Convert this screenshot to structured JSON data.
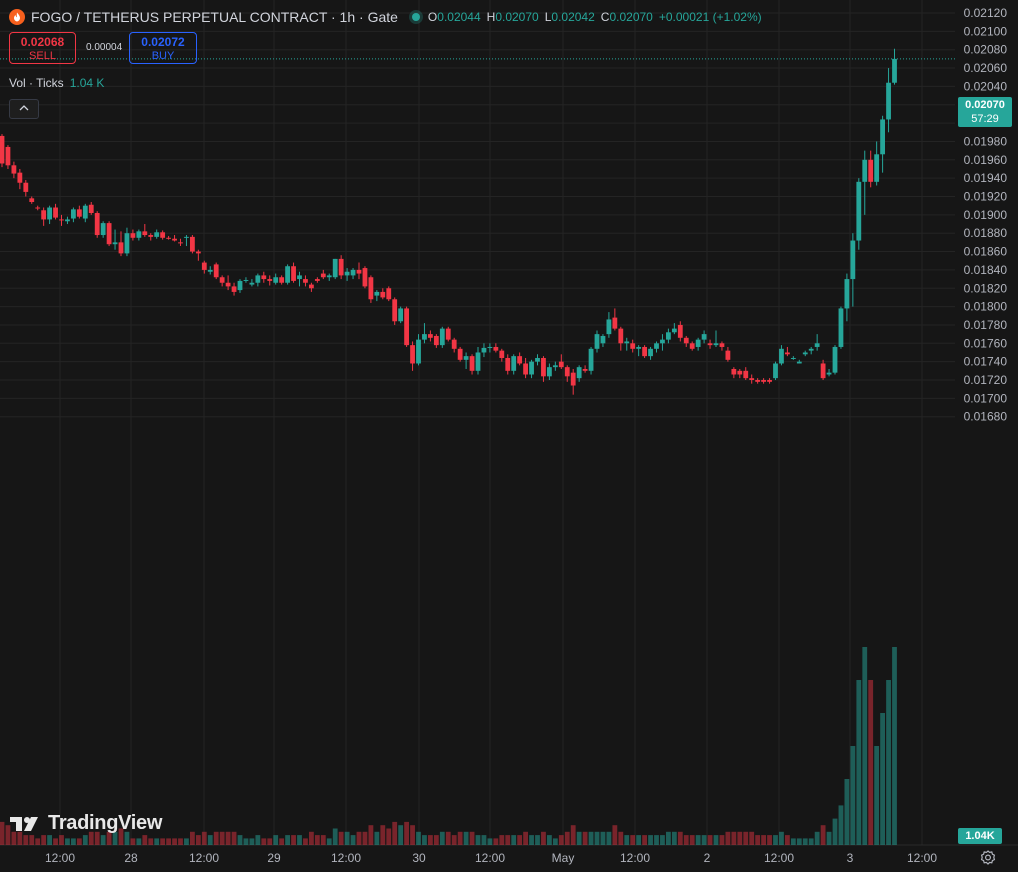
{
  "legend": {
    "symbol": "FOGO / TETHERUS PERPETUAL CONTRACT · 1h · Gate",
    "o_label": "O",
    "o": "0.02044",
    "h_label": "H",
    "h": "0.02070",
    "l_label": "L",
    "l": "0.02042",
    "c_label": "C",
    "c": "0.02070",
    "change": "+0.00021 (+1.02%)"
  },
  "trade": {
    "sell_price": "0.02068",
    "sell_label": "SELL",
    "spread": "0.00004",
    "buy_price": "0.02072",
    "buy_label": "BUY"
  },
  "volume_legend": {
    "label": "Vol · Ticks",
    "value": "1.04 K"
  },
  "price_tag": {
    "price": "0.02070",
    "countdown": "57:29"
  },
  "volume_tag": "1.04K",
  "watermark": "TradingView",
  "colors": {
    "up": "#26a69a",
    "down": "#f23645",
    "background": "#161616",
    "grid": "#242424",
    "axis_text": "#b2b5be"
  },
  "chart_data": {
    "type": "candlestick",
    "title": "FOGO / TETHERUS PERPETUAL CONTRACT · 1h · Gate",
    "y_axis": {
      "ticks": [
        "0.02120",
        "0.02100",
        "0.02080",
        "0.02060",
        "0.02040",
        "0.02020",
        "0.02000",
        "0.01980",
        "0.01960",
        "0.01940",
        "0.01920",
        "0.01900",
        "0.01880",
        "0.01860",
        "0.01840",
        "0.01820",
        "0.01800",
        "0.01780",
        "0.01760",
        "0.01740",
        "0.01720",
        "0.01700",
        "0.01680"
      ],
      "range": [
        0.01672,
        0.02126
      ]
    },
    "x_axis": {
      "ticks": [
        "12:00",
        "28",
        "12:00",
        "29",
        "12:00",
        "30",
        "12:00",
        "May",
        "12:00",
        "2",
        "12:00",
        "3",
        "12:00"
      ]
    },
    "last_price": 0.0207,
    "candles": [
      [
        0.01986,
        0.01988,
        0.01952,
        0.01956,
        0.35
      ],
      [
        0.01974,
        0.01976,
        0.0195,
        0.01954,
        0.3
      ],
      [
        0.01954,
        0.01958,
        0.0194,
        0.01945,
        0.2
      ],
      [
        0.01946,
        0.0195,
        0.01928,
        0.01935,
        0.2
      ],
      [
        0.01935,
        0.01938,
        0.0192,
        0.01925,
        0.15
      ],
      [
        0.01918,
        0.0192,
        0.01912,
        0.01914,
        0.15
      ],
      [
        0.01908,
        0.0191,
        0.01905,
        0.01907,
        0.1
      ],
      [
        0.01905,
        0.01908,
        0.01888,
        0.01895,
        0.15
      ],
      [
        0.01895,
        0.0191,
        0.0189,
        0.01908,
        0.15
      ],
      [
        0.01908,
        0.01912,
        0.01895,
        0.01897,
        0.1
      ],
      [
        0.01895,
        0.019,
        0.01888,
        0.01894,
        0.15
      ],
      [
        0.01893,
        0.01898,
        0.0189,
        0.01895,
        0.1
      ],
      [
        0.01896,
        0.01908,
        0.01892,
        0.01906,
        0.1
      ],
      [
        0.01906,
        0.0191,
        0.01896,
        0.01898,
        0.1
      ],
      [
        0.01896,
        0.01912,
        0.01892,
        0.0191,
        0.15
      ],
      [
        0.01911,
        0.01914,
        0.019,
        0.01902,
        0.2
      ],
      [
        0.01902,
        0.01904,
        0.01875,
        0.01878,
        0.2
      ],
      [
        0.01878,
        0.01893,
        0.01875,
        0.01891,
        0.15
      ],
      [
        0.01891,
        0.01893,
        0.01866,
        0.01868,
        0.2
      ],
      [
        0.01868,
        0.01884,
        0.01862,
        0.0187,
        0.2
      ],
      [
        0.0187,
        0.01882,
        0.01855,
        0.01858,
        0.25
      ],
      [
        0.01858,
        0.01886,
        0.01855,
        0.0188,
        0.2
      ],
      [
        0.0188,
        0.01884,
        0.01872,
        0.01875,
        0.1
      ],
      [
        0.01875,
        0.01884,
        0.01872,
        0.01882,
        0.1
      ],
      [
        0.01882,
        0.0189,
        0.01876,
        0.01878,
        0.15
      ],
      [
        0.01878,
        0.0188,
        0.01872,
        0.01876,
        0.1
      ],
      [
        0.01876,
        0.01884,
        0.01874,
        0.01881,
        0.1
      ],
      [
        0.01881,
        0.01883,
        0.01873,
        0.01875,
        0.1
      ],
      [
        0.01875,
        0.01877,
        0.01873,
        0.01874,
        0.1
      ],
      [
        0.01874,
        0.01878,
        0.01871,
        0.01872,
        0.1
      ],
      [
        0.0187,
        0.01874,
        0.01866,
        0.01869,
        0.1
      ],
      [
        0.01876,
        0.01878,
        0.01866,
        0.01876,
        0.1
      ],
      [
        0.01876,
        0.01878,
        0.01858,
        0.0186,
        0.2
      ],
      [
        0.0186,
        0.01862,
        0.0185,
        0.01858,
        0.15
      ],
      [
        0.01848,
        0.0185,
        0.01836,
        0.0184,
        0.2
      ],
      [
        0.01838,
        0.01844,
        0.01835,
        0.0184,
        0.15
      ],
      [
        0.01846,
        0.01848,
        0.0183,
        0.01832,
        0.2
      ],
      [
        0.01832,
        0.01834,
        0.01822,
        0.01826,
        0.2
      ],
      [
        0.01826,
        0.01834,
        0.01818,
        0.01822,
        0.2
      ],
      [
        0.01822,
        0.01826,
        0.01812,
        0.01816,
        0.2
      ],
      [
        0.01818,
        0.0183,
        0.01815,
        0.01828,
        0.15
      ],
      [
        0.01828,
        0.01832,
        0.01826,
        0.01829,
        0.1
      ],
      [
        0.01824,
        0.0183,
        0.01822,
        0.01826,
        0.1
      ],
      [
        0.01826,
        0.01836,
        0.01822,
        0.01834,
        0.15
      ],
      [
        0.01834,
        0.01838,
        0.01826,
        0.0183,
        0.1
      ],
      [
        0.0183,
        0.01834,
        0.01823,
        0.01828,
        0.1
      ],
      [
        0.01826,
        0.01836,
        0.01824,
        0.01832,
        0.15
      ],
      [
        0.01832,
        0.01834,
        0.01824,
        0.01826,
        0.1
      ],
      [
        0.01826,
        0.01846,
        0.01824,
        0.01844,
        0.15
      ],
      [
        0.01844,
        0.01848,
        0.01826,
        0.01828,
        0.15
      ],
      [
        0.0183,
        0.01838,
        0.01822,
        0.01834,
        0.15
      ],
      [
        0.0183,
        0.01834,
        0.01822,
        0.01826,
        0.1
      ],
      [
        0.01824,
        0.01826,
        0.01816,
        0.0182,
        0.2
      ],
      [
        0.0183,
        0.01832,
        0.01826,
        0.01828,
        0.15
      ],
      [
        0.01836,
        0.0184,
        0.0183,
        0.01832,
        0.15
      ],
      [
        0.01832,
        0.01836,
        0.01828,
        0.01834,
        0.1
      ],
      [
        0.01832,
        0.01852,
        0.0183,
        0.01852,
        0.25
      ],
      [
        0.01852,
        0.01856,
        0.0183,
        0.01834,
        0.2
      ],
      [
        0.01834,
        0.01842,
        0.01828,
        0.01838,
        0.2
      ],
      [
        0.01834,
        0.01842,
        0.0183,
        0.0184,
        0.15
      ],
      [
        0.0184,
        0.01848,
        0.0183,
        0.01836,
        0.2
      ],
      [
        0.01842,
        0.01844,
        0.0182,
        0.01822,
        0.2
      ],
      [
        0.01832,
        0.01834,
        0.01804,
        0.01808,
        0.3
      ],
      [
        0.01812,
        0.01818,
        0.01806,
        0.01816,
        0.2
      ],
      [
        0.01816,
        0.0182,
        0.01808,
        0.0181,
        0.3
      ],
      [
        0.0182,
        0.01822,
        0.01806,
        0.01808,
        0.25
      ],
      [
        0.01808,
        0.0181,
        0.0178,
        0.01784,
        0.35
      ],
      [
        0.01784,
        0.018,
        0.01782,
        0.01798,
        0.3
      ],
      [
        0.01798,
        0.018,
        0.01756,
        0.01758,
        0.35
      ],
      [
        0.01758,
        0.01762,
        0.0173,
        0.01738,
        0.3
      ],
      [
        0.01738,
        0.0177,
        0.01736,
        0.01764,
        0.2
      ],
      [
        0.01764,
        0.01782,
        0.0176,
        0.0177,
        0.15
      ],
      [
        0.0177,
        0.01774,
        0.01762,
        0.01766,
        0.15
      ],
      [
        0.01768,
        0.0177,
        0.01755,
        0.01758,
        0.15
      ],
      [
        0.01758,
        0.01778,
        0.01755,
        0.01776,
        0.2
      ],
      [
        0.01776,
        0.01778,
        0.01762,
        0.01764,
        0.2
      ],
      [
        0.01764,
        0.01766,
        0.0175,
        0.01754,
        0.15
      ],
      [
        0.01754,
        0.01756,
        0.0174,
        0.01742,
        0.2
      ],
      [
        0.01742,
        0.0175,
        0.01732,
        0.01746,
        0.2
      ],
      [
        0.01746,
        0.01748,
        0.01726,
        0.0173,
        0.2
      ],
      [
        0.0173,
        0.01756,
        0.01726,
        0.0175,
        0.15
      ],
      [
        0.0175,
        0.0176,
        0.01745,
        0.01755,
        0.15
      ],
      [
        0.01755,
        0.0176,
        0.0175,
        0.01756,
        0.1
      ],
      [
        0.01756,
        0.0176,
        0.0175,
        0.01752,
        0.1
      ],
      [
        0.01752,
        0.01754,
        0.0174,
        0.01744,
        0.15
      ],
      [
        0.01744,
        0.01748,
        0.01726,
        0.0173,
        0.15
      ],
      [
        0.0173,
        0.01748,
        0.01726,
        0.01746,
        0.15
      ],
      [
        0.01746,
        0.0175,
        0.01736,
        0.01738,
        0.15
      ],
      [
        0.01738,
        0.01744,
        0.01722,
        0.01726,
        0.2
      ],
      [
        0.01726,
        0.01742,
        0.01722,
        0.0174,
        0.15
      ],
      [
        0.0174,
        0.01748,
        0.01736,
        0.01744,
        0.15
      ],
      [
        0.01744,
        0.01746,
        0.01718,
        0.01724,
        0.2
      ],
      [
        0.01724,
        0.01738,
        0.0172,
        0.01734,
        0.15
      ],
      [
        0.01734,
        0.0174,
        0.0173,
        0.01736,
        0.1
      ],
      [
        0.0174,
        0.01748,
        0.01732,
        0.01734,
        0.15
      ],
      [
        0.01734,
        0.01736,
        0.01718,
        0.01724,
        0.2
      ],
      [
        0.01728,
        0.01732,
        0.01704,
        0.01714,
        0.3
      ],
      [
        0.01722,
        0.01736,
        0.01718,
        0.01734,
        0.2
      ],
      [
        0.01732,
        0.01736,
        0.01728,
        0.0173,
        0.2
      ],
      [
        0.0173,
        0.01756,
        0.01726,
        0.01754,
        0.2
      ],
      [
        0.01754,
        0.01774,
        0.0175,
        0.0177,
        0.2
      ],
      [
        0.0176,
        0.0177,
        0.01756,
        0.01768,
        0.2
      ],
      [
        0.0177,
        0.01794,
        0.01766,
        0.01786,
        0.2
      ],
      [
        0.01788,
        0.01798,
        0.01774,
        0.01776,
        0.3
      ],
      [
        0.01776,
        0.01778,
        0.01752,
        0.0176,
        0.2
      ],
      [
        0.0176,
        0.01766,
        0.01752,
        0.01762,
        0.15
      ],
      [
        0.0176,
        0.01764,
        0.0175,
        0.01754,
        0.15
      ],
      [
        0.01754,
        0.01758,
        0.01746,
        0.01756,
        0.15
      ],
      [
        0.01756,
        0.01758,
        0.01744,
        0.01746,
        0.15
      ],
      [
        0.01746,
        0.01756,
        0.01742,
        0.01754,
        0.15
      ],
      [
        0.01754,
        0.01762,
        0.0175,
        0.0176,
        0.15
      ],
      [
        0.0176,
        0.0177,
        0.01752,
        0.01764,
        0.15
      ],
      [
        0.01764,
        0.01776,
        0.0176,
        0.01772,
        0.2
      ],
      [
        0.01772,
        0.01782,
        0.0177,
        0.01776,
        0.2
      ],
      [
        0.0178,
        0.01784,
        0.01762,
        0.01766,
        0.2
      ],
      [
        0.01766,
        0.01768,
        0.01756,
        0.0176,
        0.15
      ],
      [
        0.0176,
        0.01762,
        0.01752,
        0.01754,
        0.15
      ],
      [
        0.01756,
        0.01766,
        0.01752,
        0.01764,
        0.15
      ],
      [
        0.01764,
        0.01774,
        0.0176,
        0.0177,
        0.15
      ],
      [
        0.0176,
        0.01764,
        0.01754,
        0.01758,
        0.15
      ],
      [
        0.01758,
        0.01774,
        0.01756,
        0.0176,
        0.15
      ],
      [
        0.0176,
        0.01762,
        0.01752,
        0.01756,
        0.15
      ],
      [
        0.01752,
        0.01756,
        0.0174,
        0.01742,
        0.2
      ],
      [
        0.01732,
        0.01734,
        0.01722,
        0.01726,
        0.2
      ],
      [
        0.0173,
        0.01732,
        0.01722,
        0.01726,
        0.2
      ],
      [
        0.0173,
        0.01734,
        0.0172,
        0.01722,
        0.2
      ],
      [
        0.01722,
        0.01726,
        0.01716,
        0.0172,
        0.2
      ],
      [
        0.0172,
        0.01722,
        0.01716,
        0.01718,
        0.15
      ],
      [
        0.0172,
        0.01722,
        0.01716,
        0.01718,
        0.15
      ],
      [
        0.0172,
        0.01722,
        0.01716,
        0.01718,
        0.15
      ],
      [
        0.01722,
        0.0174,
        0.0172,
        0.01738,
        0.15
      ],
      [
        0.01738,
        0.01758,
        0.01736,
        0.01754,
        0.2
      ],
      [
        0.0175,
        0.01756,
        0.01746,
        0.01748,
        0.15
      ],
      [
        0.01744,
        0.01746,
        0.01742,
        0.01744,
        0.1
      ],
      [
        0.01738,
        0.01742,
        0.01738,
        0.0174,
        0.1
      ],
      [
        0.01748,
        0.01752,
        0.01746,
        0.0175,
        0.1
      ],
      [
        0.01752,
        0.01756,
        0.01748,
        0.01754,
        0.1
      ],
      [
        0.01756,
        0.0177,
        0.01752,
        0.0176,
        0.2
      ],
      [
        0.01738,
        0.01742,
        0.0172,
        0.01722,
        0.3
      ],
      [
        0.01726,
        0.01732,
        0.01724,
        0.01728,
        0.2
      ],
      [
        0.01728,
        0.01758,
        0.01726,
        0.01756,
        0.4
      ],
      [
        0.01756,
        0.018,
        0.01754,
        0.01798,
        0.6
      ],
      [
        0.01798,
        0.01836,
        0.01784,
        0.0183,
        1.0
      ],
      [
        0.0183,
        0.0188,
        0.018,
        0.01872,
        1.5
      ],
      [
        0.01872,
        0.0194,
        0.01862,
        0.01936,
        2.5
      ],
      [
        0.01936,
        0.0197,
        0.019,
        0.0196,
        3.0
      ],
      [
        0.0196,
        0.0197,
        0.0193,
        0.01936,
        2.5
      ],
      [
        0.01936,
        0.0198,
        0.01932,
        0.01966,
        1.5
      ],
      [
        0.01966,
        0.02008,
        0.01946,
        0.02004,
        2.0
      ],
      [
        0.02004,
        0.0206,
        0.0199,
        0.02044,
        2.5
      ],
      [
        0.02044,
        0.02081,
        0.02042,
        0.0207,
        3.0
      ]
    ],
    "volume_max_value": "1.04K"
  }
}
